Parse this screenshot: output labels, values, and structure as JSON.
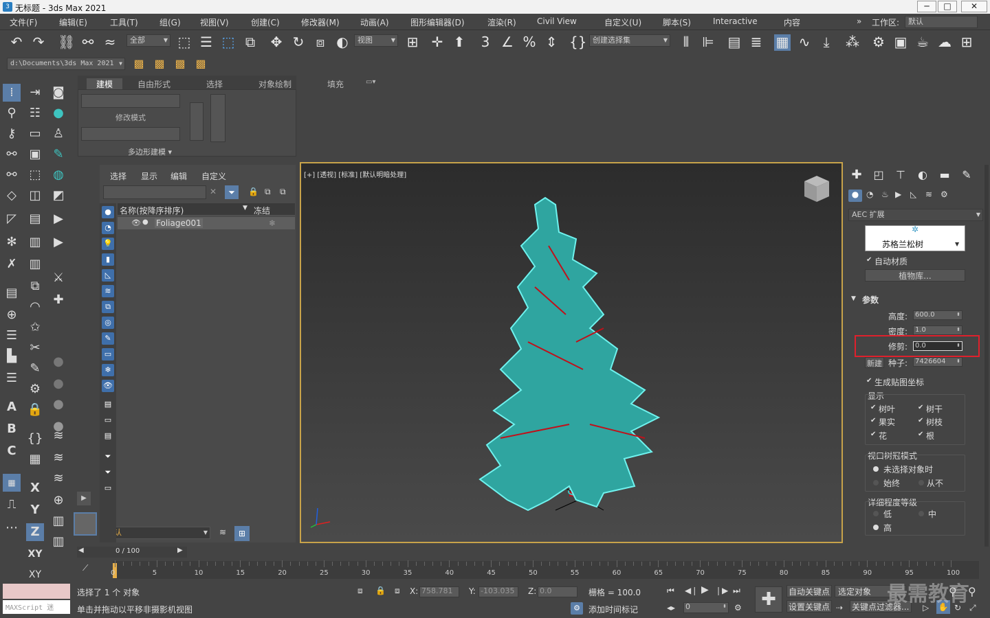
{
  "window": {
    "title": "无标题 - 3ds Max 2021",
    "min": "─",
    "max": "□",
    "close": "✕"
  },
  "menu": [
    "文件(F)",
    "编辑(E)",
    "工具(T)",
    "组(G)",
    "视图(V)",
    "创建(C)",
    "修改器(M)",
    "动画(A)",
    "图形编辑器(D)",
    "渲染(R)",
    "Civil View",
    "自定义(U)",
    "脚本(S)",
    "Interactive",
    "内容"
  ],
  "workspace": {
    "label": "工作区:",
    "value": "默认",
    "chev": "»"
  },
  "toolbar": {
    "select_filter": "全部",
    "ref_coord": "视图",
    "named_sel": "创建选择集"
  },
  "path": "d:\\Documents\\3ds Max 2021",
  "ribbon": {
    "tabs": [
      "建模",
      "自由形式",
      "选择",
      "对象绘制",
      "填充"
    ],
    "sections": [
      "修改模式",
      "多边形建模"
    ]
  },
  "scene_explorer": {
    "menus": [
      "选择",
      "显示",
      "编辑",
      "自定义"
    ],
    "col_name": "名称(按降序排序)",
    "col_freeze": "冻结",
    "items": [
      "Foliage001"
    ],
    "layer": "默认"
  },
  "viewport": {
    "label": "[+] [透视] [标准] [默认明暗处理]"
  },
  "cmd_panel": {
    "category": "AEC 扩展",
    "plant_name": "苏格兰松树",
    "auto_material": "自动材质",
    "plant_lib": "植物库...",
    "params_title": "参数",
    "height_label": "高度:",
    "height": "600.0",
    "density_label": "密度:",
    "density": "1.0",
    "prune_label": "修剪:",
    "prune": "0.0",
    "new_label": "新建",
    "seed_label": "种子:",
    "seed": "7426604",
    "gen_map": "生成贴图坐标",
    "display_title": "显示",
    "display": [
      "树叶",
      "树干",
      "果实",
      "树枝",
      "花",
      "根"
    ],
    "canopy_title": "视口树冠模式",
    "canopy": [
      "未选择对象时",
      "始终",
      "从不"
    ],
    "lod_title": "详细程度等级",
    "lod": [
      "低",
      "中",
      "高"
    ]
  },
  "timeline": {
    "frame": "0 / 100",
    "ticks": [
      "0",
      "5",
      "10",
      "15",
      "20",
      "25",
      "30",
      "35",
      "40",
      "45",
      "50",
      "55",
      "60",
      "65",
      "70",
      "75",
      "80",
      "85",
      "90",
      "95",
      "100"
    ]
  },
  "status": {
    "selected": "选择了 1 个 对象",
    "hint": "单击并拖动以平移非摄影机视图",
    "maxscript": "MAXScript 迷",
    "x_label": "X:",
    "x": "758.781",
    "y_label": "Y:",
    "y": "-103.035",
    "z_label": "Z:",
    "z": "0.0",
    "grid": "栅格 = 100.0",
    "add_time_tag": "添加时间标记",
    "auto_key": "自动关键点",
    "set_key": "设置关键点",
    "selected_obj": "选定对象",
    "key_filter": "关键点过滤器...",
    "frame_field": "0"
  },
  "watermark": "最需教育",
  "colors": {
    "highlight": "#e0202c",
    "accent": "#3f6faa",
    "viewport_border": "#c8a34a",
    "foliage": "#3ec4c0"
  }
}
